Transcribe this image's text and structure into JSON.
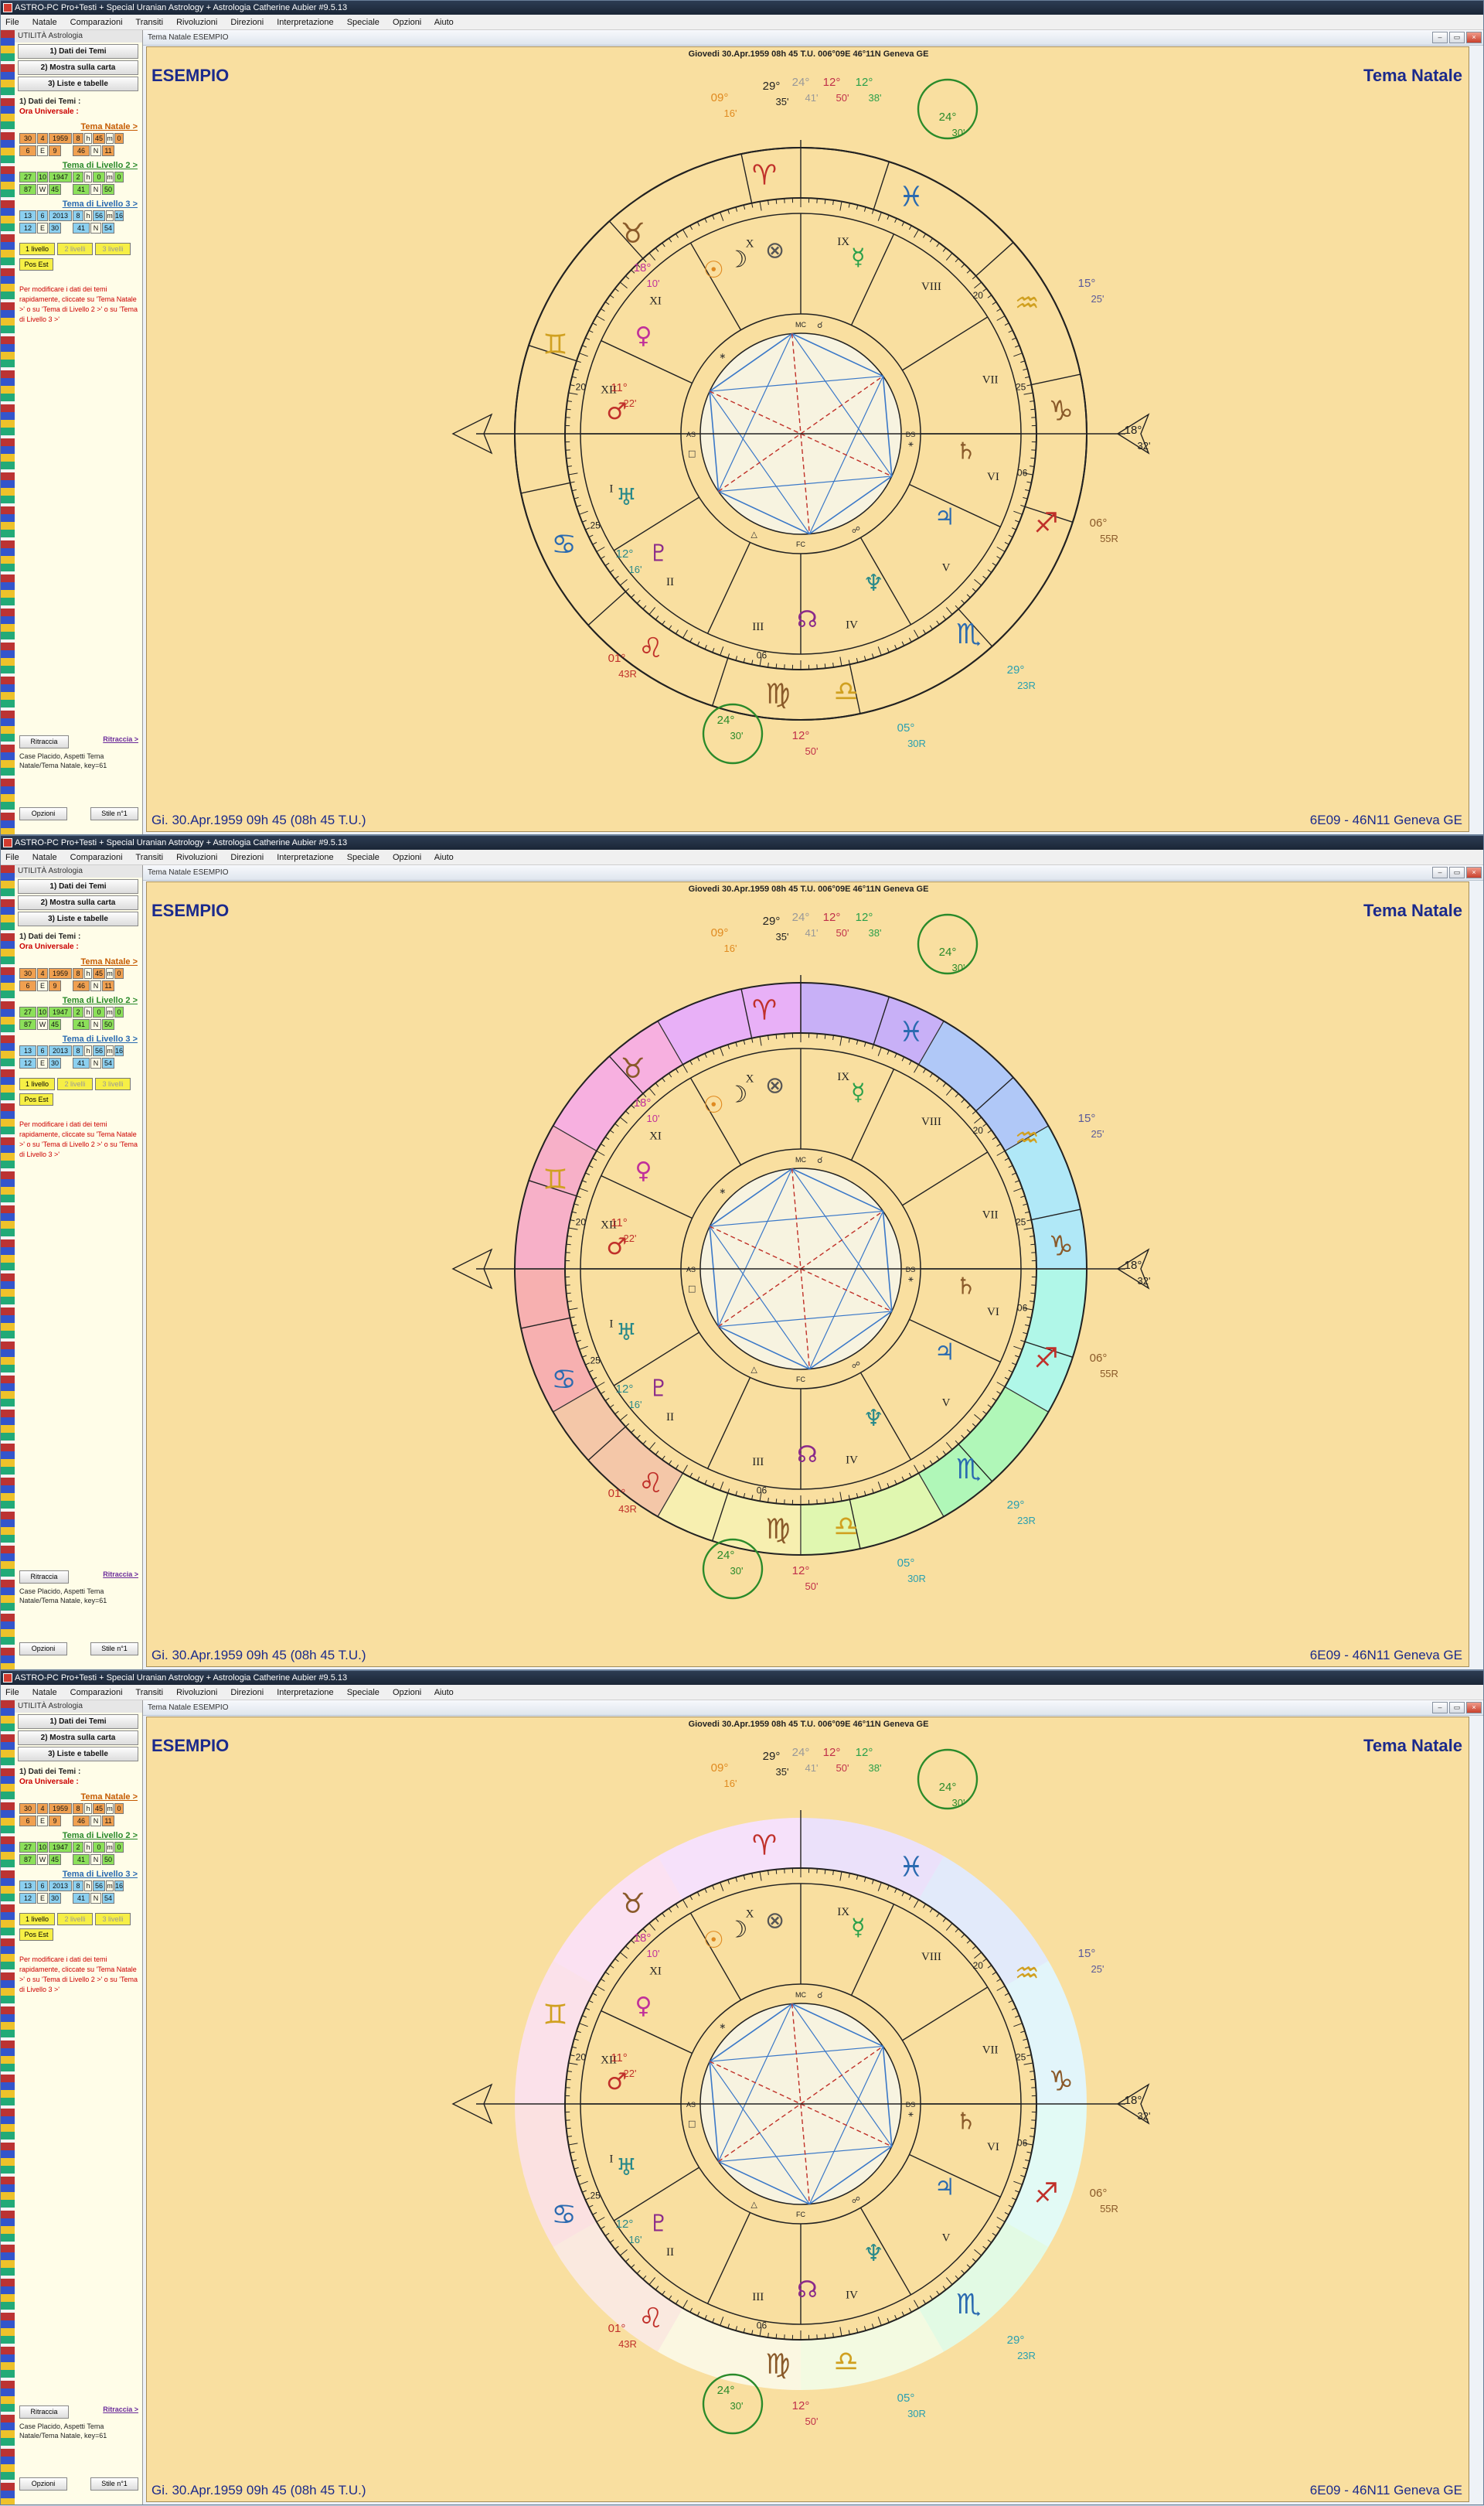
{
  "window_title": "ASTRO-PC Pro+Testi + Special Uranian Astrology + Astrologia Catherine Aubier #9.5.13",
  "menu": [
    "File",
    "Natale",
    "Comparazioni",
    "Transiti",
    "Rivoluzioni",
    "Direzioni",
    "Interpretazione",
    "Speciale",
    "Opzioni",
    "Aiuto"
  ],
  "panel": {
    "title": "UTILITÀ Astrologia",
    "buttons": [
      "1) Dati dei Temi",
      "2) Mostra sulla carta",
      "3) Liste e tabelle"
    ],
    "dati_label": "1) Dati dei Temi :",
    "ora_label": "Ora Universale :",
    "natal_link": "Tema Natale >",
    "natal_row1": [
      "30",
      "4",
      "1959",
      "8",
      "h",
      "45",
      "m",
      "0"
    ],
    "natal_row2": [
      "6",
      "E",
      "9",
      "46",
      "N",
      "11"
    ],
    "lv2_link": "Tema di Livello 2 >",
    "lv2_row1": [
      "27",
      "10",
      "1947",
      "2",
      "h",
      "0",
      "m",
      "0"
    ],
    "lv2_row2": [
      "87",
      "W",
      "45",
      "41",
      "N",
      "50"
    ],
    "lv3_link": "Tema di Livello 3 >",
    "lv3_row1": [
      "13",
      "6",
      "2013",
      "8",
      "h",
      "56",
      "m",
      "16"
    ],
    "lv3_row2": [
      "12",
      "E",
      "30",
      "41",
      "N",
      "54"
    ],
    "lv_buttons": [
      "1 livello",
      "2 livelli",
      "3 livelli"
    ],
    "pos_est": "Pos Est",
    "note": "Per modificare i dati dei temi rapidamente, cliccate su 'Tema Natale >' o su 'Tema di Livello 2 >' o su 'Tema di Livello 3 >'",
    "ritraccia_btn": "Ritraccia",
    "ritraccia_link": "Ritraccia >",
    "house_info": "Case Placido, Aspetti Tema Natale/Tema Natale, key=61",
    "opzioni": "Opzioni",
    "stile": "Stile n°1"
  },
  "chart_window": {
    "title": "Tema Natale  ESEMPIO",
    "subtitle": "Giovedi 30.Apr.1959 08h 45 T.U. 006°09E 46°11N  Geneva GE",
    "name": "ESEMPIO",
    "type_label": "Tema Natale",
    "date_line": "Gi. 30.Apr.1959 09h 45 (08h 45 T.U.)",
    "coord_line": "6E09 - 46N11  Geneva GE"
  },
  "chart_labels": [
    {
      "deg": "29°",
      "min": "35'",
      "color": "#222"
    },
    {
      "deg": "24°",
      "min": "41'",
      "color": "#999"
    },
    {
      "deg": "12°",
      "min": "50'",
      "color": "#c0304a"
    },
    {
      "deg": "12°",
      "min": "38'",
      "color": "#2aa04a"
    },
    {
      "deg": "09°",
      "min": "16'",
      "color": "#e08a20"
    },
    {
      "deg": "24°",
      "min": "30'",
      "color": "#2a8a2a"
    },
    {
      "deg": "18°",
      "min": "10'",
      "color": "#c0309a"
    },
    {
      "deg": "15°",
      "min": "25'",
      "color": "#5a5a9a"
    },
    {
      "deg": "11°",
      "min": "22'",
      "color": "#c0302a"
    },
    {
      "deg": "18°",
      "min": "32'",
      "color": "#222"
    },
    {
      "deg": "06°",
      "min": "55R",
      "color": "#8a5a2a"
    },
    {
      "deg": "12°",
      "min": "16'",
      "color": "#2a8a8a"
    },
    {
      "deg": "01°",
      "min": "43R",
      "color": "#c0302a"
    },
    {
      "deg": "29°",
      "min": "23R",
      "color": "#2aa0b0"
    },
    {
      "deg": "05°",
      "min": "30R",
      "color": "#2aa0b0"
    },
    {
      "deg": "24°",
      "min": "30'",
      "color": "#2a8a2a"
    },
    {
      "deg": "12°",
      "min": "50'",
      "color": "#c0304a"
    }
  ],
  "houses": [
    "I",
    "II",
    "III",
    "IV",
    "V",
    "VI",
    "VII",
    "VIII",
    "IX",
    "X",
    "XI",
    "XII"
  ],
  "house_cusps": [
    "20",
    "25",
    "06",
    "25",
    "20",
    "06"
  ],
  "zodiac_signs": [
    "♈",
    "♉",
    "♊",
    "♋",
    "♌",
    "♍",
    "♎",
    "♏",
    "♐",
    "♑",
    "♒",
    "♓"
  ],
  "planets": [
    "☉",
    "☽",
    "☿",
    "♀",
    "♂",
    "♃",
    "♄",
    "♅",
    "♆",
    "♇",
    "☊",
    "⊗"
  ],
  "aspect_glyphs": [
    "☌",
    "∗",
    "□",
    "△",
    "☍",
    "⚹"
  ],
  "angle_labels": [
    "AS",
    "MC",
    "DS",
    "FC"
  ],
  "colors": {
    "sign_fire": "#c0302a",
    "sign_earth": "#8a5a2a",
    "sign_air": "#d0a020",
    "sign_water": "#2a6ab0",
    "aspect_blue": "#3a78c8",
    "aspect_red": "#c03028"
  },
  "ring_styles": [
    "plain",
    "colored",
    "soft"
  ]
}
